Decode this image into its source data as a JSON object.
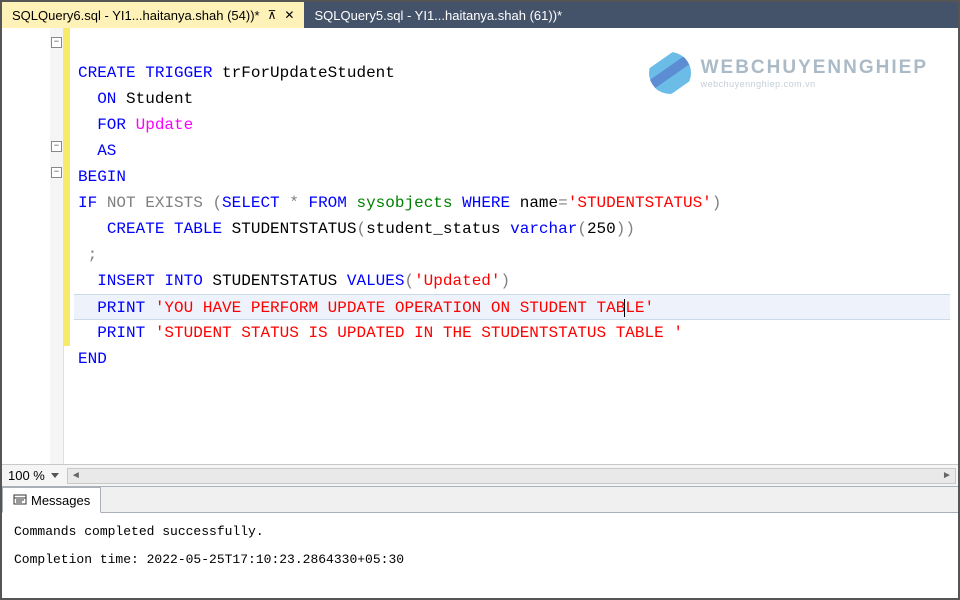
{
  "tabs": [
    {
      "label": "SQLQuery6.sql - YI1...haitanya.shah (54))*",
      "active": true
    },
    {
      "label": "SQLQuery5.sql - YI1...haitanya.shah (61))*",
      "active": false
    }
  ],
  "zoom": "100 %",
  "watermark": {
    "main": "WEBCHUYENNGHIEP",
    "sub": "webchuyennghiep.com.vn"
  },
  "code": {
    "l1": {
      "create": "CREATE",
      "trigger": "TRIGGER",
      "name": " trForUpdateStudent"
    },
    "l2": {
      "on": "ON",
      "tbl": " Student"
    },
    "l3": {
      "for": "FOR",
      "upd": "Update"
    },
    "l4": {
      "as": "AS"
    },
    "l5": {
      "begin": "BEGIN"
    },
    "l6": {
      "if": "IF",
      "not": "NOT",
      "exists": "EXISTS",
      "sel": "SELECT",
      "star": " *",
      "from": "FROM",
      "sysobj": " sysobjects",
      "where": "WHERE",
      "namekw": " name",
      "eq": "=",
      "str": "'STUDENTSTATUS'",
      "lp": " (",
      "rp": ")"
    },
    "l7": {
      "create": "CREATE",
      "table": "TABLE",
      "tbl": " STUDENTSTATUS",
      "lp": "(",
      "col": "student_status",
      "typ": "varchar",
      "lp2": "(",
      "num": "250",
      "rp2": ")",
      "rp": ")"
    },
    "l8": {
      "semi": ";"
    },
    "l9": {
      "insert": "INSERT",
      "into": "INTO",
      "tbl": " STUDENTSTATUS",
      "values": "VALUES",
      "lp": "(",
      "str": "'Updated'",
      "rp": ")"
    },
    "l10": {
      "print": "PRINT",
      "s1": "'YOU HAVE PERFORM UPDATE OPERATION ON STUDENT TAB",
      "s2": "LE'"
    },
    "l11": {
      "print": "PRINT",
      "str": "'STUDENT STATUS IS UPDATED IN THE STUDENTSTATUS TABLE '"
    },
    "l12": {
      "end": "END"
    }
  },
  "messages": {
    "tab_label": "Messages",
    "line1": "Commands completed successfully.",
    "line2": "Completion time: 2022-05-25T17:10:23.2864330+05:30"
  }
}
